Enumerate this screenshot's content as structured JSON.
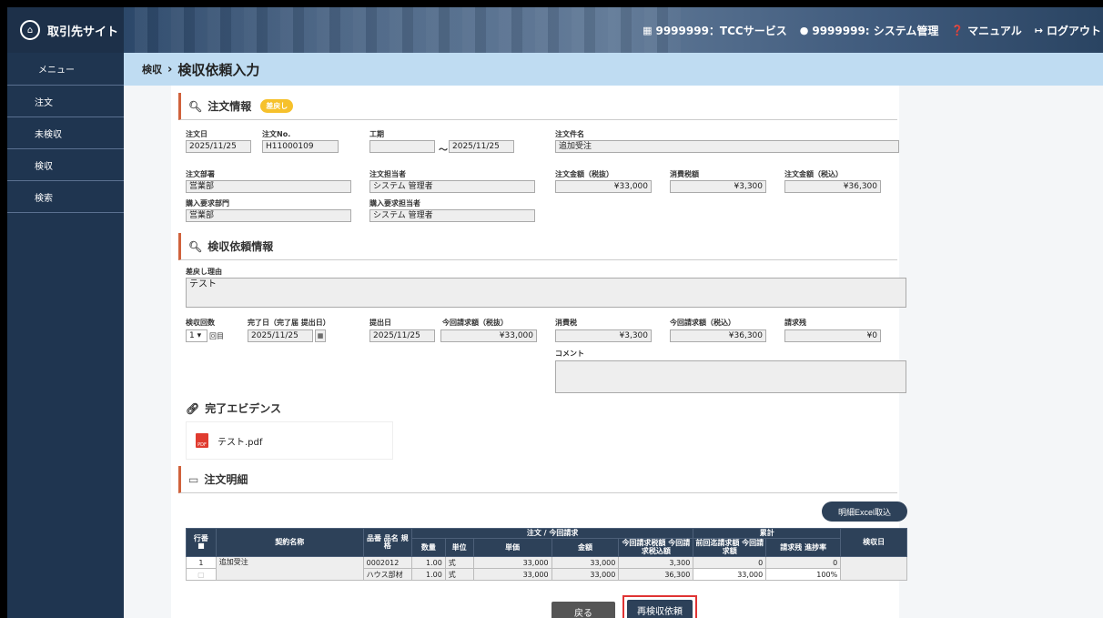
{
  "header": {
    "brand": "取引先サイト",
    "company": "9999999：TCCサービス",
    "user": "9999999: システム管理",
    "manual": "マニュアル",
    "logout": "ログアウト"
  },
  "sidebar": {
    "items": [
      {
        "label": "メニュー"
      },
      {
        "label": "注文"
      },
      {
        "label": "未検収"
      },
      {
        "label": "検収"
      },
      {
        "label": "検索"
      }
    ]
  },
  "breadcrumb": {
    "parent": "検収",
    "separator": "›",
    "current": "検収依頼入力"
  },
  "order_info": {
    "title": "注文情報",
    "badge": "差戻し",
    "order_date_label": "注文日",
    "order_date": "2025/11/25",
    "order_no_label": "注文No.",
    "order_no": "H11000109",
    "period_label": "工期",
    "period_from": "",
    "period_tilde": "～",
    "period_to": "2025/11/25",
    "order_name_label": "注文件名",
    "order_name": "追加受注",
    "dept_label": "注文部署",
    "dept": "営業部",
    "person_label": "注文担当者",
    "person": "システム 管理者",
    "amount_ex_label": "注文金額（税抜）",
    "amount_ex": "¥33,000",
    "tax_label": "消費税額",
    "tax": "¥3,300",
    "amount_in_label": "注文金額（税込）",
    "amount_in": "¥36,300",
    "req_dept_label": "購入要求部門",
    "req_dept": "営業部",
    "req_person_label": "購入要求担当者",
    "req_person": "システム 管理者"
  },
  "inspection": {
    "title": "検収依頼情報",
    "reason_label": "差戻し理由",
    "reason": "テスト",
    "count_label": "検収回数",
    "count": "1",
    "count_suffix": "回目",
    "done_label": "完了日（完了届 提出日）",
    "done_date": "2025/11/25",
    "submit_label": "提出日",
    "submit_date": "2025/11/25",
    "req_ex_label": "今回請求額（税抜）",
    "req_ex": "¥33,000",
    "tax_label": "消費税",
    "tax": "¥3,300",
    "req_in_label": "今回請求額（税込）",
    "req_in": "¥36,300",
    "remain_label": "請求残",
    "remain": "¥0",
    "comment_label": "コメント"
  },
  "evidence": {
    "title": "完了エビデンス",
    "file": "テスト.pdf",
    "file_icon": "PDF"
  },
  "details": {
    "title": "注文明細",
    "excel_button": "明細Excel取込",
    "headers": {
      "row_no": "行番",
      "contract": "契約名称",
      "item": "品番 品名 規格",
      "group1": "注文 / 今回請求",
      "qty": "数量",
      "unit": "単位",
      "price": "単価",
      "amount": "金額",
      "cur_tax": "今回請求税額 今回請求税込額",
      "group2": "累計",
      "prev": "前回迄請求額 今回請求額",
      "remain": "請求残 進捗率",
      "inspect_date": "検収日"
    },
    "row": {
      "no": "1",
      "contract": "追加受注",
      "item1": "0002012",
      "item2": "ハウス部材",
      "qty1": "1.00",
      "qty2": "1.00",
      "unit1": "式",
      "unit2": "式",
      "price1": "33,000",
      "price2": "33,000",
      "amount1": "33,000",
      "amount2": "33,000",
      "tax1": "3,300",
      "tax2": "36,300",
      "prev1": "0",
      "prev2": "33,000",
      "remain1": "0",
      "remain2": "100%"
    }
  },
  "footer": {
    "back": "戻る",
    "resubmit": "再検収依頼"
  }
}
